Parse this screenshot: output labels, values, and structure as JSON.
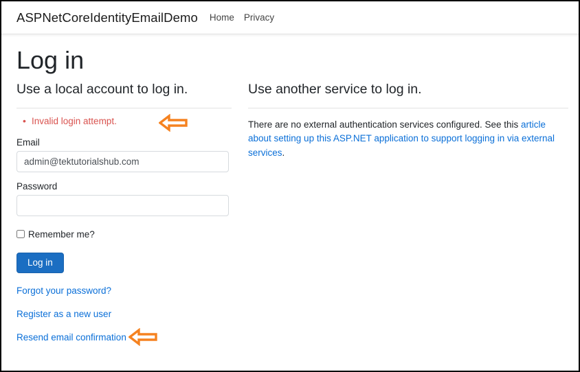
{
  "navbar": {
    "brand": "ASPNetCoreIdentityEmailDemo",
    "links": [
      {
        "label": "Home"
      },
      {
        "label": "Privacy"
      }
    ]
  },
  "page": {
    "title": "Log in"
  },
  "local_login": {
    "heading": "Use a local account to log in.",
    "validation_errors": [
      "Invalid login attempt."
    ],
    "email": {
      "label": "Email",
      "value": "admin@tektutorialshub.com",
      "placeholder": "Email"
    },
    "password": {
      "label": "Password",
      "value": "",
      "placeholder": ""
    },
    "remember_me": {
      "label": "Remember me?",
      "checked": false
    },
    "submit_label": "Log in",
    "links": [
      {
        "label": "Forgot your password?"
      },
      {
        "label": "Register as a new user"
      },
      {
        "label": "Resend email confirmation"
      }
    ]
  },
  "external_login": {
    "heading": "Use another service to log in.",
    "paragraph_prefix": "There are no external authentication services configured. See this ",
    "paragraph_link": "article about setting up this ASP.NET application to support logging in via external services",
    "paragraph_suffix": "."
  },
  "annotations": [
    {
      "name": "arrow-pointing-at-validation-error",
      "icon": "left-arrow-icon"
    },
    {
      "name": "arrow-pointing-at-resend-email-confirmation",
      "icon": "left-arrow-icon"
    }
  ],
  "colors": {
    "primary_button": "#1b6ec2",
    "link": "#0a6fd8",
    "error_text": "#d9534f",
    "annotation_arrow": "#f58220",
    "border": "#000000"
  }
}
